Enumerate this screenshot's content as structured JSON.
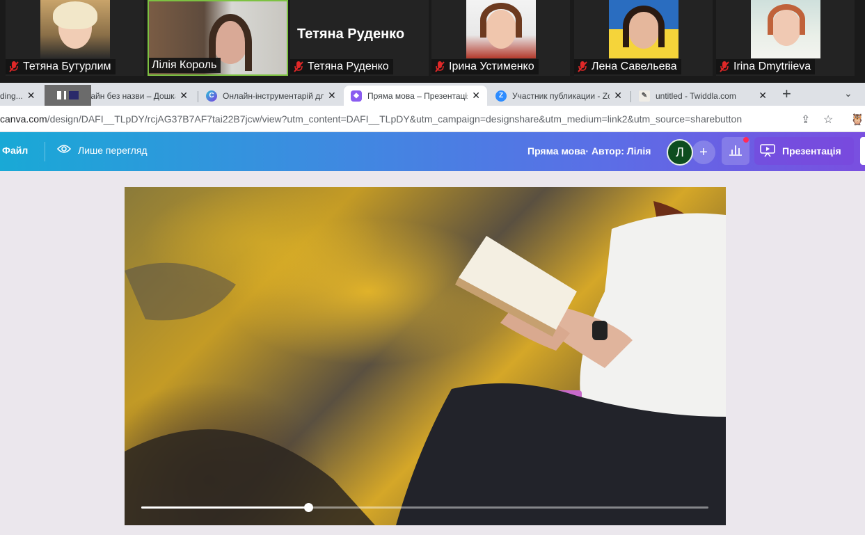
{
  "zoom": {
    "participants": [
      {
        "name": "Тетяна Бутурлим",
        "muted": true,
        "video": true
      },
      {
        "name": "Лілія Король",
        "muted": false,
        "video": true,
        "active_speaker": true
      },
      {
        "name": "Тетяна Руденко",
        "muted": true,
        "video": false,
        "display_name": "Тетяна Руденко"
      },
      {
        "name": "Ірина Устименко",
        "muted": true,
        "video": true
      },
      {
        "name": "Лена Савельева",
        "muted": true,
        "video": true
      },
      {
        "name": "Irina Dmytriieva",
        "muted": true,
        "video": true
      }
    ]
  },
  "browser": {
    "tabs": [
      {
        "label": "ding...",
        "icon": "loading-icon",
        "active": false
      },
      {
        "label": "Дизайн без назви – Дошка",
        "icon": "canva-icon",
        "active": false
      },
      {
        "label": "Онлайн-інструментарій для",
        "icon": "canva-c-icon",
        "active": false
      },
      {
        "label": "Пряма мова – Презентація",
        "icon": "canva-present-icon",
        "active": true
      },
      {
        "label": "Участник публикации - Zo",
        "icon": "zoom-icon",
        "active": false
      },
      {
        "label": "untitled - Twiddla.com",
        "icon": "twiddla-icon",
        "active": false
      }
    ],
    "new_tab": "+",
    "url_host": "canva.com",
    "url_path": "/design/DAFI__TLpDY/rcjAG37B7AF7tai22B7jcw/view?utm_content=DAFI__TLpDY&utm_campaign=designshare&utm_medium=link2&utm_source=sharebutton"
  },
  "canva": {
    "file_label": "Файл",
    "view_only_label": "Лише перегляд",
    "doc_title": "Пряма мова",
    "author": "· Автор: Лілія",
    "avatar_initial": "Л",
    "add_label": "+",
    "present_label": "Презентація",
    "colors": {
      "accent": "#7a4fe0",
      "avatar_bg": "#0d4d1f"
    }
  },
  "video": {
    "progress": 0.295
  }
}
